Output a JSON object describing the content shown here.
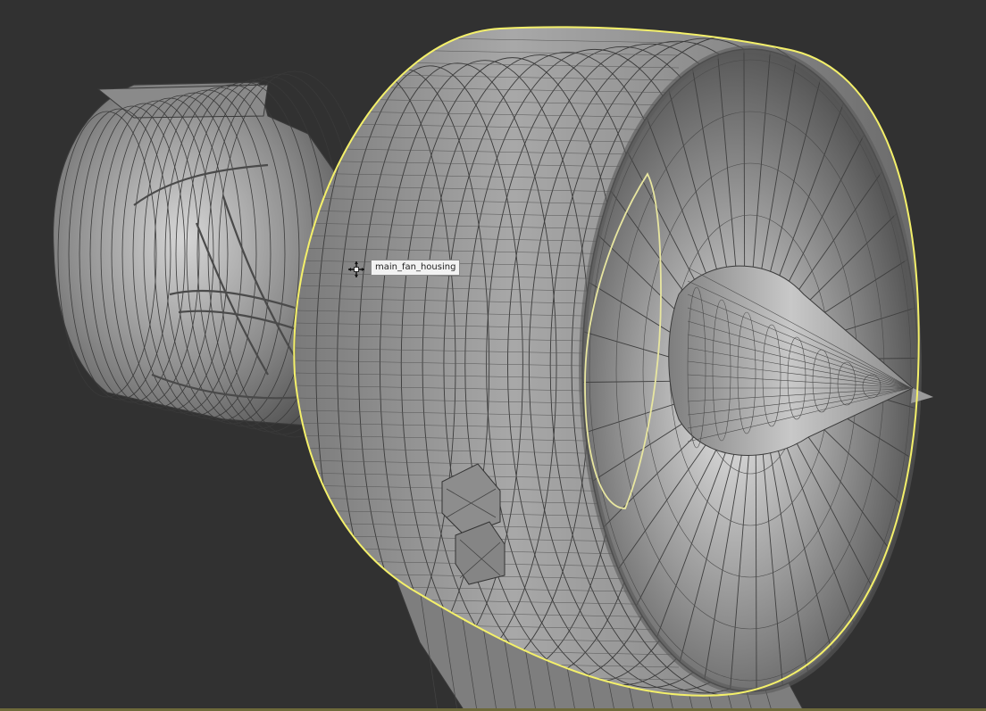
{
  "viewport": {
    "tooltip_text": "main_fan_housing",
    "selected_object": "main_fan_housing",
    "colors": {
      "background": "#313131",
      "mesh_fill": "#9c9c9c",
      "wire": "#3c3c3c",
      "selection": "#f4f06a"
    },
    "cursor_icon": "move-crosshair-icon",
    "fan_blade_count": 40,
    "housing_ring_count": 14
  }
}
